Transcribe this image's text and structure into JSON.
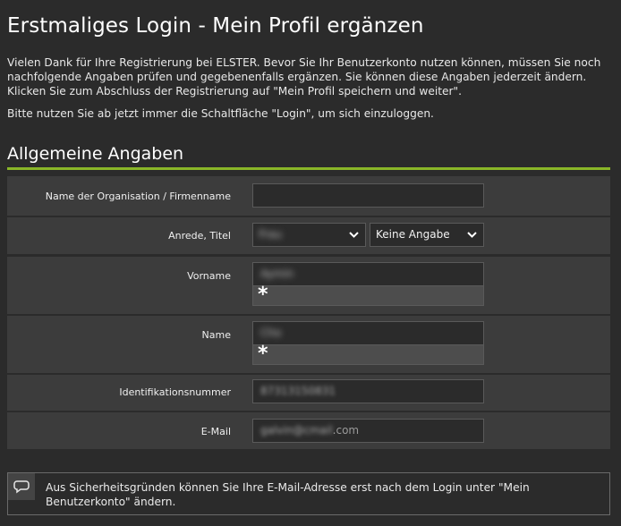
{
  "page": {
    "title": "Erstmaliges Login - Mein Profil ergänzen",
    "intro_paragraph": "Vielen Dank für Ihre Registrierung bei ELSTER. Bevor Sie Ihr Benutzerkonto nutzen können, müssen Sie noch nachfolgende Angaben prüfen und gegebenenfalls ergänzen. Sie können diese Angaben jederzeit ändern. Klicken Sie zum Abschluss der Registrierung auf \"Mein Profil speichern und weiter\".",
    "login_hint": "Bitte nutzen Sie ab jetzt immer die Schaltfläche \"Login\", um sich einzuloggen."
  },
  "section": {
    "title": "Allgemeine Angaben",
    "accent_color": "#8ab628"
  },
  "form": {
    "organisation": {
      "label": "Name der Organisation / Firmenname",
      "value": ""
    },
    "anrede": {
      "label": "Anrede,  Titel",
      "anrede_value": "Frau",
      "titel_value": "Keine Angabe"
    },
    "vorname": {
      "label": "Vorname",
      "value": "Aymin",
      "required_mark": "*"
    },
    "name": {
      "label": "Name",
      "value": "Cho",
      "required_mark": "*"
    },
    "id_number": {
      "label": "Identifikationsnummer",
      "value": "87313150831"
    },
    "email": {
      "label": "E-Mail",
      "value_local": "galvin@cmail",
      "value_suffix": ".com"
    }
  },
  "notice": {
    "icon": "speech-bubble-icon",
    "text": "Aus Sicherheitsgründen können Sie Ihre E-Mail-Adresse erst nach dem Login unter \"Mein Benutzerkonto\" ändern."
  }
}
